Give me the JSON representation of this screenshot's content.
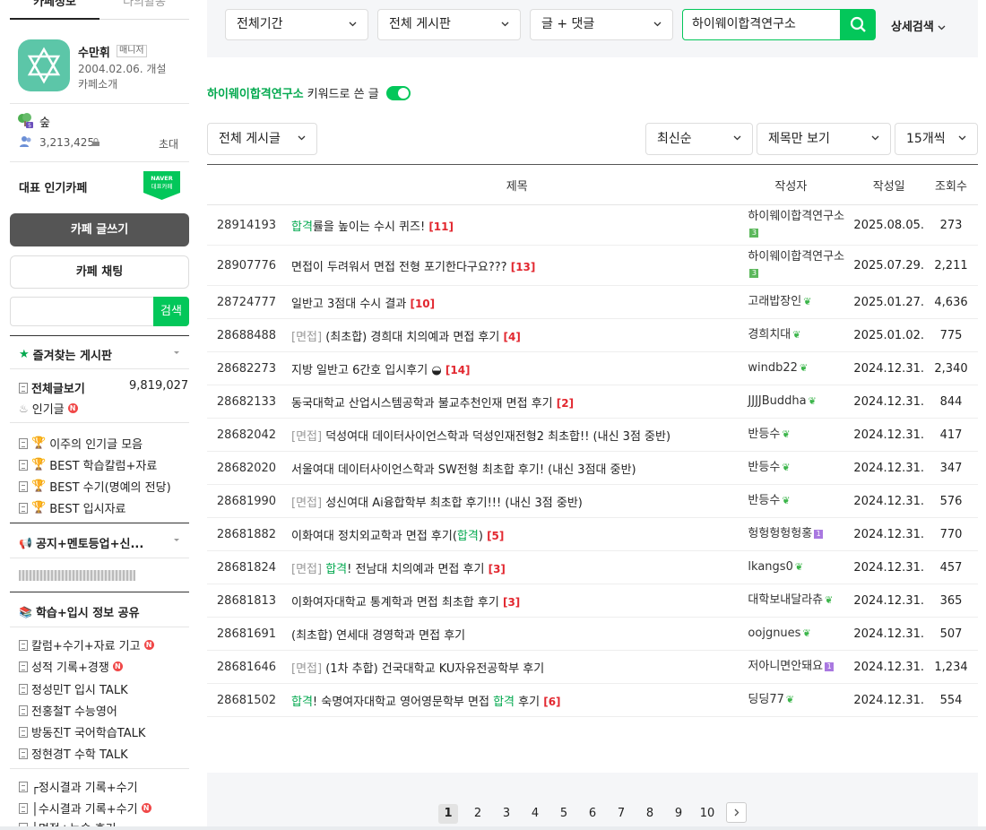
{
  "sidebar": {
    "tabs": [
      "카페정보",
      "나의활동"
    ],
    "manager": {
      "name": "수만휘",
      "badge": "매니저",
      "since": "2004.02.06. 개설",
      "intro": "카페소개"
    },
    "grade": "숲",
    "members": "3,213,425",
    "invite": "초대",
    "rep": "대표 인기카페",
    "naver_badge": [
      "NAVER",
      "대표카페"
    ],
    "write": "카페 글쓰기",
    "chat": "카페 채팅",
    "search_btn": "검색",
    "fav_title": "즐겨찾는 게시판",
    "total_label": "전체글보기",
    "total_count": "9,819,027",
    "popular": "인기글",
    "best_items": [
      "이주의 인기글 모음",
      "BEST 학습칼럼+자료",
      "BEST 수기(명예의 전당)",
      "BEST 입시자료"
    ],
    "notice_title": "공지+멘토등업+신...",
    "share_title": "학습+입시 정보 공유",
    "share_items": [
      "칼럼+수기+자료 기고",
      "성적 기록+경쟁",
      "정성민T 입시 TALK",
      "전홍철T 수능영어",
      "방동진T 국어학습TALK",
      "정현경T 수학 TALK"
    ],
    "result_items": [
      "┌정시결과 기록+수기",
      "│수시결과 기록+수기",
      "│면접+논술 후기"
    ]
  },
  "filters": {
    "period": "전체기간",
    "board": "전체 게시판",
    "type": "글 + 댓글",
    "query": "하이웨이합격연구소",
    "detail": "상세검색"
  },
  "keyword_line": {
    "keyword": "하이웨이합격연구소",
    "suffix": "키워드로 쓴 글"
  },
  "options": {
    "board": "전체 게시글",
    "sort": "최신순",
    "view": "제목만 보기",
    "count": "15개씩"
  },
  "table": {
    "headers": [
      "제목",
      "작성자",
      "작성일",
      "조회수"
    ],
    "rows": [
      {
        "no": "28914193",
        "prefix": "",
        "hl1": "합격",
        "title": "률을 높이는 수시 퀴즈!",
        "hl2": "",
        "tail": "",
        "comments": "[11]",
        "author": "하이웨이합격연구소",
        "level": "3",
        "date": "2025.08.05.",
        "views": "273"
      },
      {
        "no": "28907776",
        "prefix": "",
        "hl1": "",
        "title": "면접이 두려워서 면접 전형 포기한다구요???",
        "hl2": "",
        "tail": "",
        "comments": "[13]",
        "author": "하이웨이합격연구소",
        "level": "3",
        "date": "2025.07.29.",
        "views": "2,211"
      },
      {
        "no": "28724777",
        "prefix": "",
        "hl1": "",
        "title": "일반고 3점대 수시 결과",
        "hl2": "",
        "tail": "",
        "comments": "[10]",
        "author": "고래밥장인",
        "level": "",
        "date": "2025.01.27.",
        "views": "4,636"
      },
      {
        "no": "28688488",
        "prefix": "[면접]",
        "hl1": "",
        "title": "(최초합) 경희대 치의예과 면접 후기",
        "hl2": "",
        "tail": "",
        "comments": "[4]",
        "author": "경희치대",
        "level": "",
        "date": "2025.01.02.",
        "views": "775"
      },
      {
        "no": "28682273",
        "prefix": "",
        "hl1": "",
        "title": "지방 일반고 6간호 입시후기 ◒",
        "hl2": "",
        "tail": "",
        "comments": "[14]",
        "author": "windb22",
        "level": "",
        "date": "2024.12.31.",
        "views": "2,340"
      },
      {
        "no": "28682133",
        "prefix": "",
        "hl1": "",
        "title": "동국대학교 산업시스템공학과 불교추천인재 면접 후기",
        "hl2": "",
        "tail": "",
        "comments": "[2]",
        "author": "JJJJBuddha",
        "level": "",
        "date": "2024.12.31.",
        "views": "844"
      },
      {
        "no": "28682042",
        "prefix": "[면접]",
        "hl1": "",
        "title": "덕성여대 데이터사이언스학과 덕성인재전형2 최초합!! (내신 3점 중반)",
        "hl2": "",
        "tail": "",
        "comments": "",
        "author": "반등수",
        "level": "",
        "date": "2024.12.31.",
        "views": "417"
      },
      {
        "no": "28682020",
        "prefix": "",
        "hl1": "",
        "title": "서울여대 데이터사이언스학과 SW전형 최초합 후기! (내신 3점대 중반)",
        "hl2": "",
        "tail": "",
        "comments": "",
        "author": "반등수",
        "level": "",
        "date": "2024.12.31.",
        "views": "347"
      },
      {
        "no": "28681990",
        "prefix": "[면접]",
        "hl1": "",
        "title": "성신여대 Ai융합학부 최초합 후기!!! (내신 3점 중반)",
        "hl2": "",
        "tail": "",
        "comments": "",
        "author": "반등수",
        "level": "",
        "date": "2024.12.31.",
        "views": "576"
      },
      {
        "no": "28681882",
        "prefix": "",
        "hl1": "",
        "title": "이화여대 정치외교학과 면접 후기(",
        "hl2": "합격",
        "tail": ")",
        "comments": "[5]",
        "author": "헝헝헝헝헝홍",
        "level": "1",
        "date": "2024.12.31.",
        "views": "770"
      },
      {
        "no": "28681824",
        "prefix": "[면접]",
        "hl1": "합격",
        "title": "! 전남대 치의예과 면접 후기",
        "hl2": "",
        "tail": "",
        "comments": "[3]",
        "author": "lkangs0",
        "level": "",
        "date": "2024.12.31.",
        "views": "457"
      },
      {
        "no": "28681813",
        "prefix": "",
        "hl1": "",
        "title": "이화여자대학교 통계학과 면접 최초합 후기",
        "hl2": "",
        "tail": "",
        "comments": "[3]",
        "author": "대학보내달라츄",
        "level": "",
        "date": "2024.12.31.",
        "views": "365"
      },
      {
        "no": "28681691",
        "prefix": "",
        "hl1": "",
        "title": "(최초합) 연세대 경영학과 면접 후기",
        "hl2": "",
        "tail": "",
        "comments": "",
        "author": "oojgnues",
        "level": "",
        "date": "2024.12.31.",
        "views": "507"
      },
      {
        "no": "28681646",
        "prefix": "[면접]",
        "hl1": "",
        "title": "(1차 추합) 건국대학교 KU자유전공학부 후기",
        "hl2": "",
        "tail": "",
        "comments": "",
        "author": "저아니면안돼요",
        "level": "1",
        "date": "2024.12.31.",
        "views": "1,234"
      },
      {
        "no": "28681502",
        "prefix": "",
        "hl1": "합격",
        "title": "! 숙명여자대학교 영어영문학부 면접 ",
        "hl2": "합격",
        "tail": " 후기",
        "comments": "[6]",
        "author": "딩딩77",
        "level": "",
        "date": "2024.12.31.",
        "views": "554"
      }
    ]
  },
  "pagination": {
    "pages": [
      "1",
      "2",
      "3",
      "4",
      "5",
      "6",
      "7",
      "8",
      "9",
      "10"
    ],
    "current": "1"
  },
  "colors": {
    "accent": "#03c75a",
    "comment": "#e2272f",
    "level3": "#5cb85c",
    "level1": "#a978e0"
  }
}
